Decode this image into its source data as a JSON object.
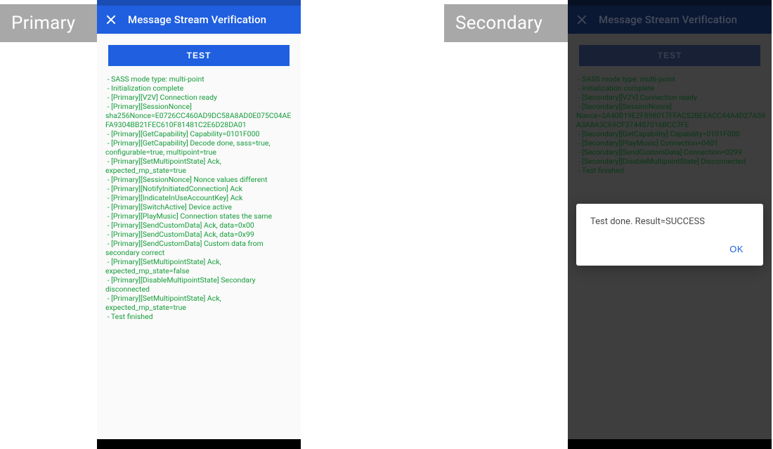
{
  "labels": {
    "primary_title": "Primary",
    "secondary_title": "Secondary"
  },
  "app_bar": {
    "title": "Message Stream Verification"
  },
  "buttons": {
    "test_label": "TEST",
    "dialog_ok_label": "OK"
  },
  "dialog": {
    "message": "Test done. Result=SUCCESS"
  },
  "logs": {
    "primary": " - SASS mode type: multi-point\n - Initialization complete\n - [Primary][V2V] Connection ready\n - [Primary][SessionNonce] sha256Nonce=E0726CC460AD9DC58A8AD0E075C04AEFA9304BB21FEC610F81481C2E6D28DA01\n - [Primary][GetCapability] Capability=0101F000\n - [Primary][GetCapability] Decode done, sass=true, configurable=true, multipoint=true\n - [Primary][SetMultipointState] Ack, expected_mp_state=true\n - [Primary][SessionNonce] Nonce values different\n - [Primary][NotifyInitiatedConnection] Ack\n - [Primary][IndicateInUseAccountKey] Ack\n - [Primary][SwitchActive] Device active\n - [Primary][PlayMusic] Connection states the same\n - [Primary][SendCustomData] Ack, data=0x00\n - [Primary][SendCustomData] Ack, data=0x99\n - [Primary][SendCustomData] Custom data from secondary correct\n - [Primary][SetMultipointState] Ack, expected_mp_state=false\n - [Primary][DisableMultipointState] Secondary disconnected\n - [Primary][SetMultipointState] Ack, expected_mp_state=true\n - Test finished",
    "secondary": " - SASS mode type: multi-point\n - Initialization complete\n - [Secondary][V2V] Connection ready\n - [Secondary][SessionNonce] Nonce=3A40B19E2F898017FFAC52BEEACC44A4D27A59A3A8A3C69CF374457016BCC7FE\n - [Secondary][GetCapability] Capability=0101F000\n - [Secondary][PlayMusic] Connection=0401\n - [Secondary][SendCustomData] Connection=0299\n - [Secondary][DisableMultipointState] Disconnected\n - Test finished"
  }
}
